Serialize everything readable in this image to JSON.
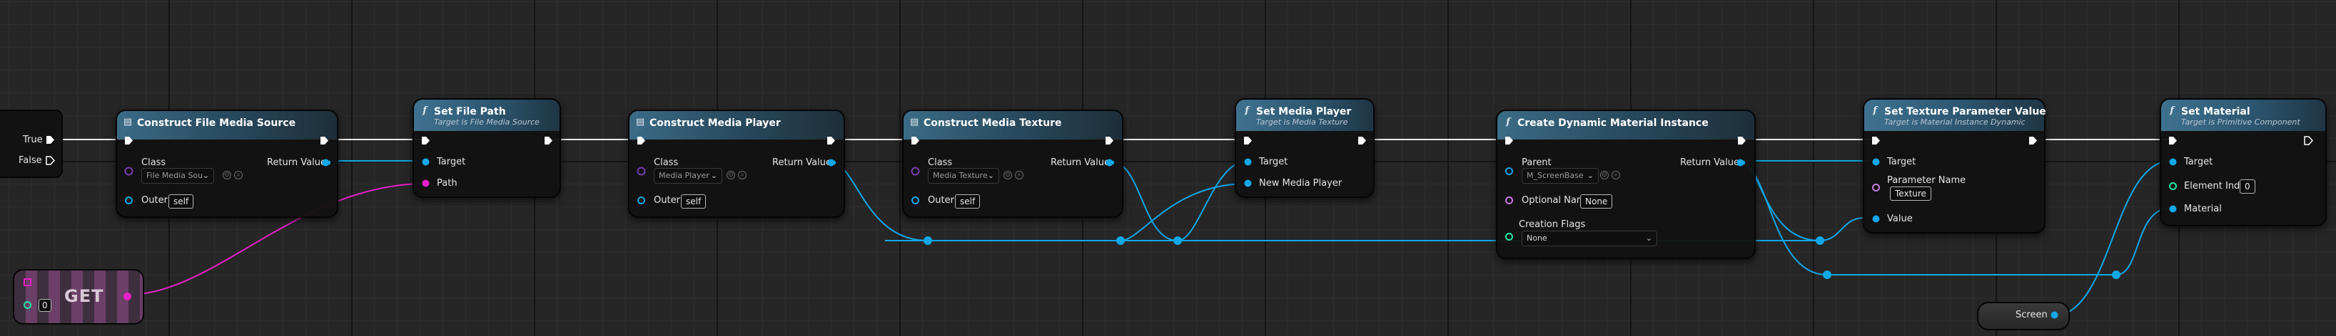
{
  "colors": {
    "exec": "#ffffff",
    "object": "#12a8e8",
    "string": "#e620c8",
    "integer": "#25e8a8",
    "name": "#c77adf",
    "material": "#12a8e8",
    "bool": "#c60000"
  },
  "branch": {
    "true_label": "True",
    "false_label": "False"
  },
  "construct_file_media_source": {
    "title": "Construct File Media Source",
    "class_label": "Class",
    "class_value": "File Media Sou",
    "return_label": "Return Value",
    "outer_label": "Outer",
    "outer_value": "self"
  },
  "set_file_path": {
    "title": "Set File Path",
    "subtitle": "Target is File Media Source",
    "target_label": "Target",
    "path_label": "Path"
  },
  "construct_media_player": {
    "title": "Construct Media Player",
    "class_label": "Class",
    "class_value": "Media Player",
    "return_label": "Return Value",
    "outer_label": "Outer",
    "outer_value": "self"
  },
  "construct_media_texture": {
    "title": "Construct Media Texture",
    "class_label": "Class",
    "class_value": "Media Texture",
    "return_label": "Return Value",
    "outer_label": "Outer",
    "outer_value": "self"
  },
  "set_media_player": {
    "title": "Set Media Player",
    "subtitle": "Target is Media Texture",
    "target_label": "Target",
    "new_player_label": "New Media Player"
  },
  "create_dynamic_material": {
    "title": "Create Dynamic Material Instance",
    "parent_label": "Parent",
    "parent_value": "M_ScreenBase",
    "return_label": "Return Value",
    "optional_name_label": "Optional Name",
    "optional_name_value": "None",
    "creation_flags_label": "Creation Flags",
    "creation_flags_value": "None"
  },
  "set_texture_param": {
    "title": "Set Texture Parameter Value",
    "subtitle": "Target is Material Instance Dynamic",
    "target_label": "Target",
    "param_name_label": "Parameter Name",
    "param_name_value": "Texture",
    "value_label": "Value"
  },
  "set_material": {
    "title": "Set Material",
    "subtitle": "Target is Primitive Component",
    "target_label": "Target",
    "element_index_label": "Element Index",
    "element_index_value": "0",
    "material_label": "Material"
  },
  "get_node": {
    "label": "GET",
    "index_value": "0"
  },
  "screen_node": {
    "label": "Screen"
  }
}
